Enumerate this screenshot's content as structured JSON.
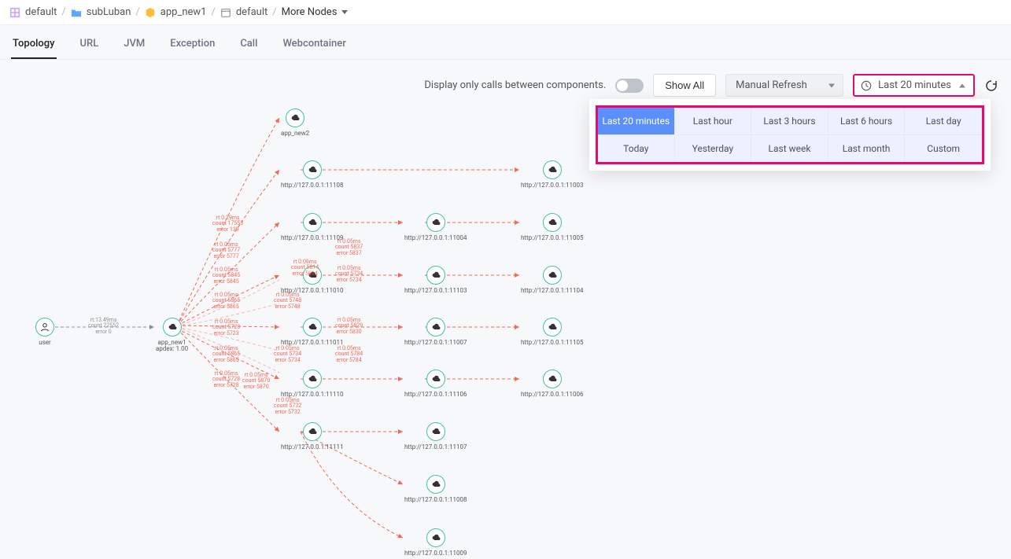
{
  "breadcrumb": {
    "items": [
      {
        "label": "default",
        "icon": "grid"
      },
      {
        "label": "subLuban",
        "icon": "folder"
      },
      {
        "label": "app_new1",
        "icon": "package"
      },
      {
        "label": "default",
        "icon": "calendar"
      },
      {
        "label": "More Nodes",
        "icon": "caret"
      }
    ]
  },
  "tabs": [
    {
      "label": "Topology",
      "active": true
    },
    {
      "label": "URL"
    },
    {
      "label": "JVM"
    },
    {
      "label": "Exception"
    },
    {
      "label": "Call"
    },
    {
      "label": "Webcontainer"
    }
  ],
  "toolbar": {
    "display_only_label": "Display only calls between components.",
    "show_all_label": "Show All",
    "refresh_mode": "Manual Refresh",
    "time_range_selected": "Last 20 minutes"
  },
  "time_ranges": [
    "Last 20 minutes",
    "Last hour",
    "Last 3 hours",
    "Last 6 hours",
    "Last day",
    "Today",
    "Yesterday",
    "Last week",
    "Last month",
    "Custom"
  ],
  "nodes": {
    "user": {
      "label1": "user",
      "label2": ""
    },
    "app": {
      "label1": "app_new1",
      "label2": "apdex: 1.00"
    },
    "c1_0": {
      "label1": "app_new2",
      "label2": ""
    },
    "c1_1": {
      "label1": "http://127.0.0.1:11108",
      "label2": ""
    },
    "c1_2": {
      "label1": "http://127.0.0.1:11109",
      "label2": ""
    },
    "c1_3": {
      "label1": "http://127.0.0.1:11010",
      "label2": ""
    },
    "c1_4": {
      "label1": "http://127.0.0.1:11011",
      "label2": ""
    },
    "c1_5": {
      "label1": "http://127.0.0.1:11110",
      "label2": ""
    },
    "c1_6": {
      "label1": "http://127.0.0.1:11111",
      "label2": ""
    },
    "c2_1": {
      "label1": "http://127.0.0.1:11004",
      "label2": ""
    },
    "c2_2": {
      "label1": "http://127.0.0.1:11103",
      "label2": ""
    },
    "c2_3": {
      "label1": "http://127.0.0.1:11007",
      "label2": ""
    },
    "c2_4": {
      "label1": "http://127.0.0.1:11106",
      "label2": ""
    },
    "c2_5": {
      "label1": "http://127.0.0.1:11107",
      "label2": ""
    },
    "c2_6": {
      "label1": "http://127.0.0.1:11008",
      "label2": ""
    },
    "c2_7": {
      "label1": "http://127.0.0.1:11009",
      "label2": ""
    },
    "c3_0": {
      "label1": "http://127.0.0.1:11003",
      "label2": ""
    },
    "c3_1": {
      "label1": "http://127.0.0.1:11005",
      "label2": ""
    },
    "c3_2": {
      "label1": "http://127.0.0.1:11104",
      "label2": ""
    },
    "c3_3": {
      "label1": "http://127.0.0.1:11105",
      "label2": ""
    },
    "c3_5": {
      "label1": "http://127.0.0.1:11006",
      "label2": ""
    }
  },
  "edge_labels": {
    "user_app": "rt:13.49ms\ncount 22552\nerror 0",
    "e0": "rt 0.29ms\ncount 17553\nerror 139",
    "e1": "rt 0.05ms\ncount 5777\nerror 5777",
    "e2": "rt 0.05ms\ncount 5845\nerror 5845",
    "e3a": "rt 0.06ms\ncount 5814\nerror 5814",
    "e3b": "rt 0.05ms\ncount 5837\nerror 5837",
    "e3c": "rt 0.05ms\ncount 5734\nerror 5734",
    "e4": "rt 0.05ms\ncount 5865\nerror 5865",
    "e4a": "rt 0.05ms\ncount 5748\nerror 5748",
    "e5": "rt 0.05ms\ncount 5723\nerror 5723",
    "e4b": "rt 0.05ms\ncount 5829\nerror 5830",
    "e4c": "rt 0.05ms\ncount 5784\nerror 5784",
    "e6": "rt 0.05ms\ncount 5734\nerror 5734",
    "e7": "rt 0.05ms\ncount 5728\nerror 5728",
    "e7a": "rt 0.05ms\ncount 5870\nerror 5870",
    "e8": "rt 0.05ms\ncount 5732\nerror 5732",
    "e9": "rt 0.05ms\ncount 5865\nerror 5865"
  }
}
